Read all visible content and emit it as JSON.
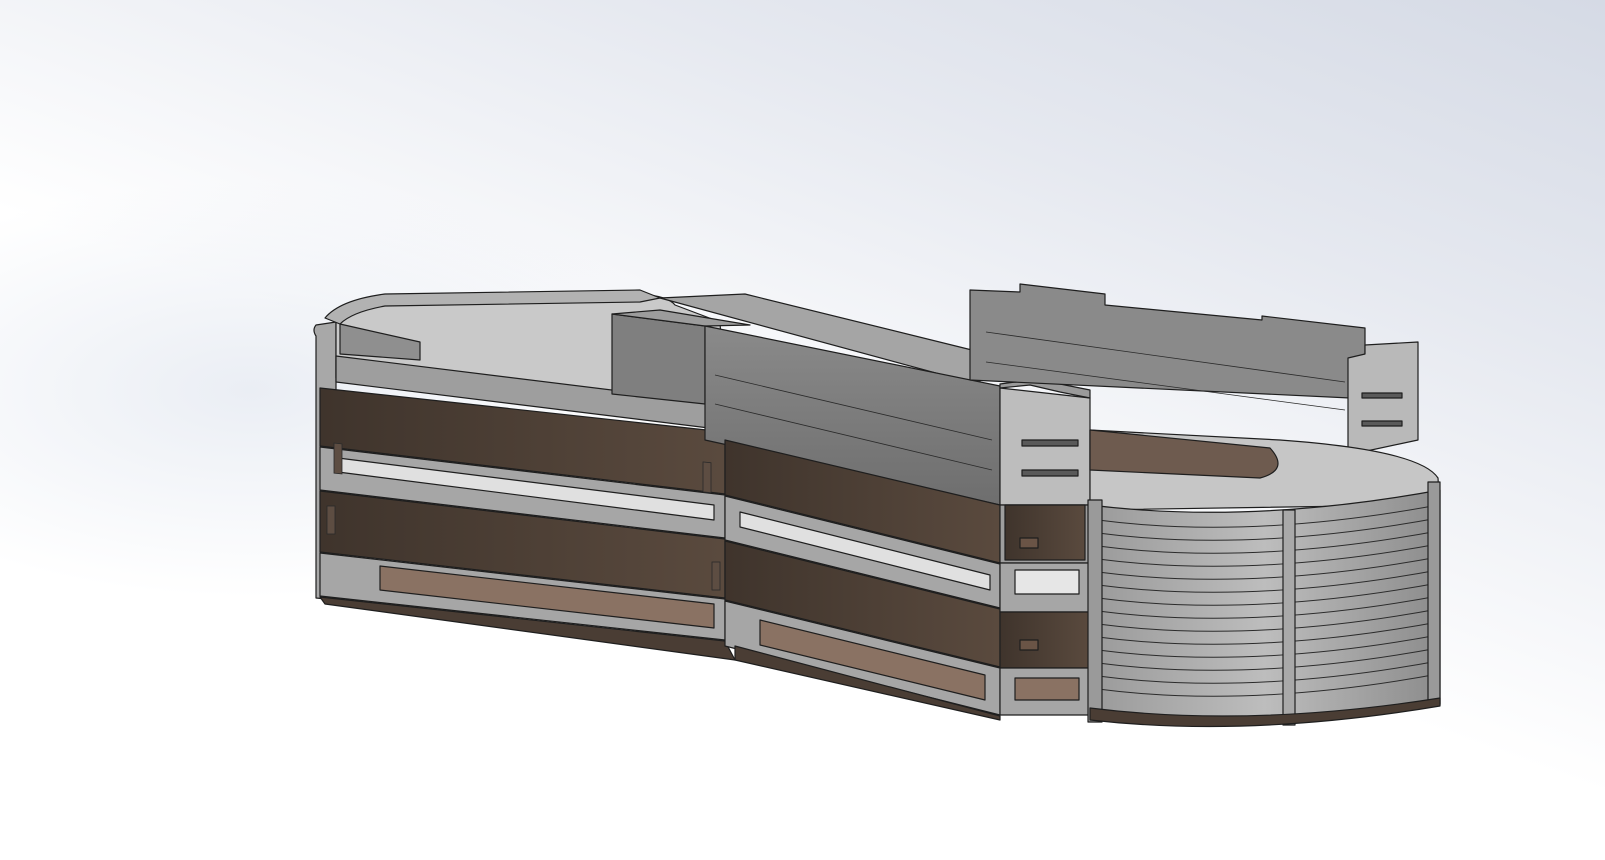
{
  "viewport": {
    "background_top": "#d5dae5",
    "background_bottom": "#ffffff"
  },
  "model": {
    "description_icon": "parking-garage-3d-model",
    "colors": {
      "concrete_light": "#c8c8c8",
      "concrete_mid": "#a9a9a9",
      "concrete_dark": "#7d7d7d",
      "facade_brown": "#4a3d34",
      "facade_brown_light": "#7b6454",
      "edge": "#1e1e1e"
    }
  }
}
